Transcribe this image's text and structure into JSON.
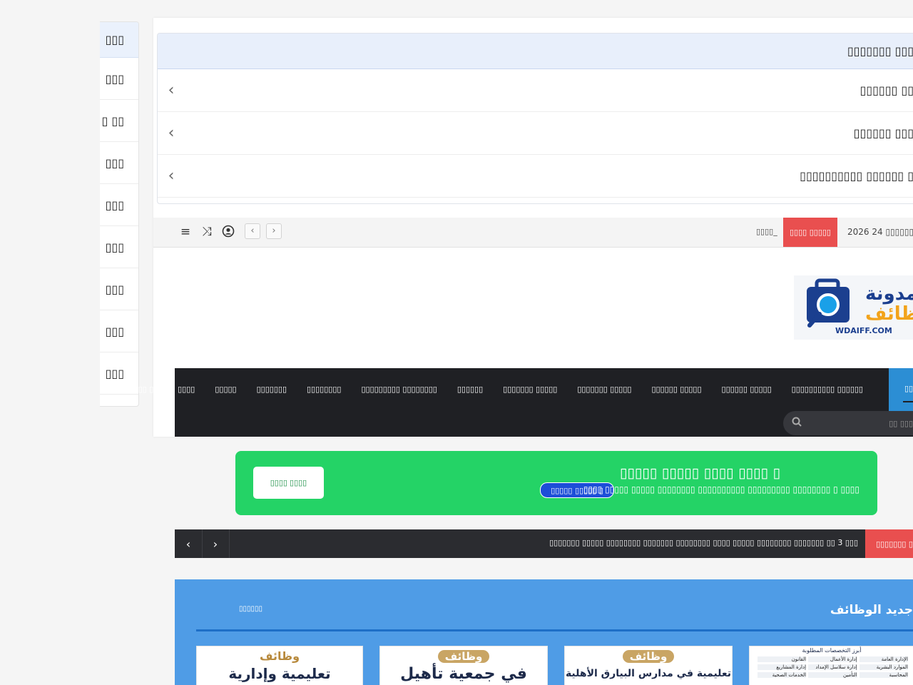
{
  "sidebar": {
    "rows": [
      "▯▯▯",
      "▯▯▯",
      "▯ ▯▯",
      "▯▯▯",
      "▯▯▯",
      "▯▯▯",
      "▯▯▯",
      "▯▯▯",
      "▯▯▯"
    ]
  },
  "accordion": {
    "header": "▯▯▯▯▯▯▯ ▯▯▯",
    "rows": [
      "▯▯▯▯▯▯ ▯▯",
      "▯▯▯▯▯▯ ▯▯▯",
      "▯▯▯▯▯▯▯▯▯▯ ▯▯▯▯▯▯ ▯"
    ]
  },
  "topbar": {
    "date": "2026 24 ▯▯▯▯▯▯ ,",
    "breaking_label": "▯▯▯▯ ▯▯▯▯▯",
    "ticker_text": "▯▯▯▯_"
  },
  "logo": {
    "line1": "مدونة",
    "line2": "ظائف",
    "domain": "WDAIFF.COM"
  },
  "nav": {
    "items": [
      "▯▯▯▯▯▯▯▯▯▯ ▯▯▯▯▯▯",
      "▯▯▯▯▯▯ ▯▯▯▯▯",
      "▯▯▯▯▯▯ ▯▯▯▯▯",
      "▯▯▯▯▯▯▯ ▯▯▯▯▯",
      "▯▯▯▯▯▯▯ ▯▯▯▯▯",
      "▯▯▯▯▯▯",
      "▯▯▯▯▯▯▯▯▯ ▯▯▯▯▯▯▯▯",
      "▯▯▯▯▯▯▯▯",
      "▯▯▯▯▯▯▯",
      "▯▯▯▯▯",
      "▯▯▯ ▯▯ ▯▯▯▯▯▯ ▯▯▯▯"
    ],
    "active_label": "▯▯▯▯",
    "search_placeholder": "▯▯ ▯▯▯"
  },
  "banner": {
    "title": "▯▯▯▯▯ ▯▯▯▯▯ ▯▯▯▯ ▯▯▯▯ ▯",
    "subtitle": "▯▯▯▯ ▯▯▯▯▯ ▯▯▯▯▯ ▯▯▯▯▯▯▯▯ ▯▯▯▯▯▯▯▯▯▯ ▯▯▯▯▯▯▯▯▯ ▯▯▯▯▯▯▯▯ ▯ ▯▯▯▯",
    "pill": "▯▯▯▯▯ ▯▯▯▯▯ ▯",
    "button": "▯▯▯▯ ▯▯▯▯"
  },
  "ticker2": {
    "label": "▯▯▯▯▯▯▯ ▯",
    "text": "▯▯▯▯▯▯▯ ▯▯▯▯▯ ▯▯▯▯▯▯▯▯ ▯▯▯▯▯▯▯ ▯▯▯▯▯▯▯▯ ▯▯▯▯ ▯▯▯▯▯ ▯▯▯▯▯▯▯▯ ▯▯▯▯▯▯▯ ▯▯ 3 ▯▯▯"
  },
  "section": {
    "title": "جديد الوظائف",
    "more": "▯▯▯▯▯▯",
    "cards": [
      {
        "kicker": "وظائف",
        "headline": "تعليمية وإدارية"
      },
      {
        "kicker": "وظائف",
        "headline": "في جمعية تأهيل"
      },
      {
        "kicker": "وظائف",
        "headline": "تعليمية في مدارس البيارق الأهلية"
      },
      {
        "kicker": "أبرز التخصصات المطلوبة",
        "headline": ""
      }
    ],
    "card4_items": [
      "الإدارة العامة",
      "إدارة الأعمال",
      "القانون",
      "الموارد البشرية",
      "إدارة سلاسل الإمداد",
      "إدارة المشاريع",
      "المحاسبة",
      "التأمين",
      "الخدمات الصحية"
    ]
  },
  "colors": {
    "nav_bg": "#1f2024",
    "accent_blue": "#2c8ed4",
    "breaking_red": "#e94f4f",
    "banner_green": "#24d366",
    "section_blue": "#4f9ce6"
  }
}
